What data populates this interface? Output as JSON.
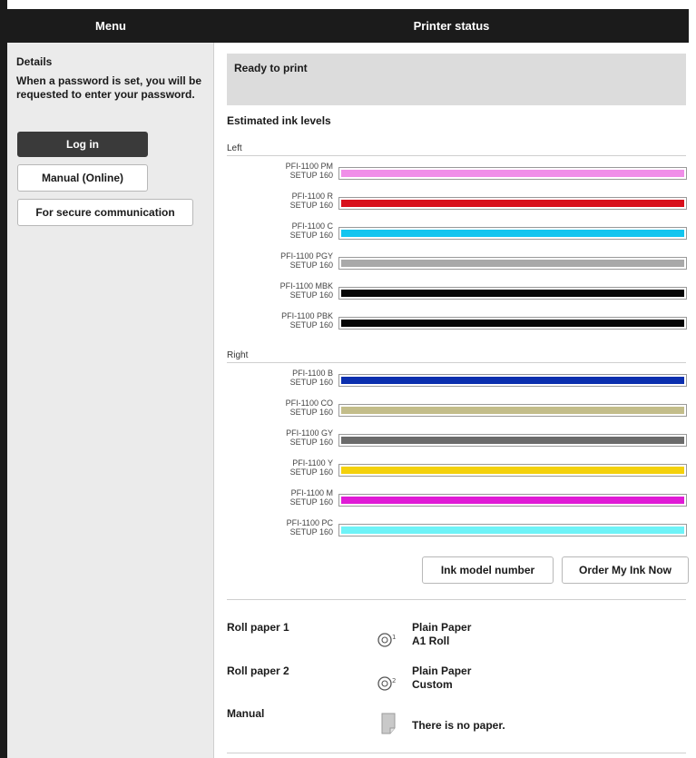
{
  "header": {
    "menu_title": "Menu",
    "status_title": "Printer status"
  },
  "sidebar": {
    "heading": "Details",
    "note": "When a password is set, you will be requested to enter your password.",
    "login_label": "Log in",
    "manual_label": "Manual (Online)",
    "secure_label": "For secure communication"
  },
  "status": {
    "message": "Ready to print"
  },
  "ink": {
    "title": "Estimated ink levels",
    "left_label": "Left",
    "right_label": "Right",
    "left": [
      {
        "model": "PFI-1100 PM",
        "setup": "SETUP 160",
        "color": "#f08ee8",
        "level": 1.0
      },
      {
        "model": "PFI-1100 R",
        "setup": "SETUP 160",
        "color": "#d8101c",
        "level": 1.0
      },
      {
        "model": "PFI-1100 C",
        "setup": "SETUP 160",
        "color": "#13c5ef",
        "level": 1.0
      },
      {
        "model": "PFI-1100 PGY",
        "setup": "SETUP 160",
        "color": "#a9a9a9",
        "level": 1.0
      },
      {
        "model": "PFI-1100 MBK",
        "setup": "SETUP 160",
        "color": "#050505",
        "level": 1.0
      },
      {
        "model": "PFI-1100 PBK",
        "setup": "SETUP 160",
        "color": "#050505",
        "level": 1.0
      }
    ],
    "right": [
      {
        "model": "PFI-1100 B",
        "setup": "SETUP 160",
        "color": "#0b2fae",
        "level": 1.0
      },
      {
        "model": "PFI-1100 CO",
        "setup": "SETUP 160",
        "color": "#c3bd8a",
        "level": 1.0
      },
      {
        "model": "PFI-1100 GY",
        "setup": "SETUP 160",
        "color": "#6b6b6b",
        "level": 1.0
      },
      {
        "model": "PFI-1100 Y",
        "setup": "SETUP 160",
        "color": "#f4d10c",
        "level": 1.0
      },
      {
        "model": "PFI-1100 M",
        "setup": "SETUP 160",
        "color": "#e01bd6",
        "level": 1.0
      },
      {
        "model": "PFI-1100 PC",
        "setup": "SETUP 160",
        "color": "#6ef3f7",
        "level": 1.0
      }
    ],
    "model_button": "Ink model number",
    "order_button": "Order My Ink Now"
  },
  "paper": [
    {
      "label": "Roll paper 1",
      "icon": "roll-paper-1-icon",
      "line1": "Plain Paper",
      "line2": "A1 Roll"
    },
    {
      "label": "Roll paper 2",
      "icon": "roll-paper-2-icon",
      "line1": "Plain Paper",
      "line2": "Custom"
    },
    {
      "label": "Manual",
      "icon": "sheet-paper-icon",
      "line1": "There is no paper.",
      "line2": ""
    }
  ]
}
